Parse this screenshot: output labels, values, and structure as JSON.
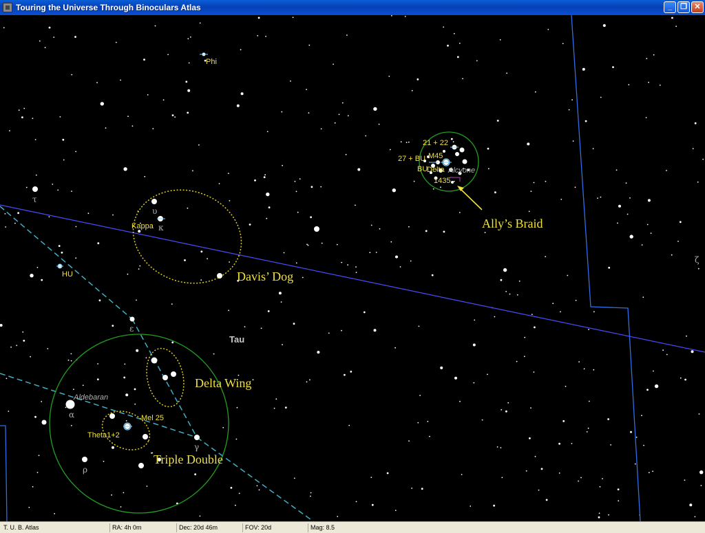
{
  "window": {
    "title": "Touring the Universe Through Binoculars Atlas",
    "minimize": "_",
    "maximize": "❐",
    "close": "✕"
  },
  "status": {
    "app": "T. U. B. Atlas",
    "ra": "RA: 4h 0m",
    "dec": "Dec: 20d 46m",
    "fov": "FOV: 20d",
    "mag": "Mag: 8.5"
  },
  "colors": {
    "star": "#ffffff",
    "label_yellow": "#f0e040",
    "boundary": "#2f6fe8",
    "ecliptic": "#4a4aff",
    "circle_green": "#22a022",
    "dotted_yellow": "#e0d020",
    "constellation_line": "#40b0c8"
  },
  "map": {
    "constellation": "Tau",
    "stars": {
      "phi": "Phi",
      "tau_greek": "τ",
      "hu": "HU",
      "upsilon": "υ",
      "kappa_greek": "κ",
      "kappa": "Kappa",
      "epsilon": "ε",
      "aldebaran": "Aldebaran",
      "alpha": "α",
      "rho": "ρ",
      "gamma": "γ",
      "theta": "Theta1+2",
      "mel25": "Mel 25",
      "zeta": "ζ",
      "m45": "M45",
      "s21_22": "21 + 22",
      "s27": "27 + BU",
      "bu_delta": "BU",
      "delta_label": "Delta",
      "alcyone": "Alcyone",
      "s1435": "1435"
    },
    "annotations": {
      "davis_dog": "Davis’ Dog",
      "allys_braid": "Ally’s Braid",
      "delta_wing": "Delta Wing",
      "triple_double": "Triple Double"
    }
  }
}
